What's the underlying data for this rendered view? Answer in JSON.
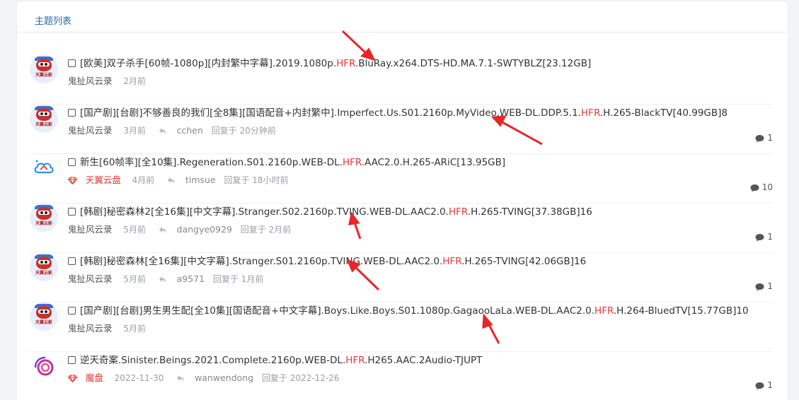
{
  "header": {
    "title": "主题列表"
  },
  "topics": [
    {
      "title_pre": "[欧美]双子杀手[60帧-1080p][内封繁中字幕].2019.1080p.",
      "hfr": "HFR",
      "title_post": ".BluRay.x264.DTS-HD.MA.7.1-SWTYBLZ[23.12GB]",
      "author": "鬼扯风云录",
      "time": "2月前",
      "replier": "",
      "reply_time": "",
      "count": ""
    },
    {
      "title_pre": "[国产剧][台剧]不够善良的我们[全8集][国语配音+内封繁中].Imperfect.Us.S01.2160p.MyVideo.WEB-DL.DDP.5.1.",
      "hfr": "HFR",
      "title_post": ".H.265-BlackTV[40.99GB]8",
      "author": "鬼扯风云录",
      "time": "3月前",
      "replier": "cchen",
      "reply_time": "回复于 20分钟前",
      "count": "1"
    },
    {
      "title_pre": "新生[60帧率][全10集].Regeneration.S01.2160p.WEB-DL.",
      "hfr": "HFR",
      "title_post": ".AAC2.0.H.265-ARiC[13.95GB]",
      "author": "天翼云盘",
      "time": "4月前",
      "replier": "timsue",
      "reply_time": "回复于 18小时前",
      "count": "10"
    },
    {
      "title_pre": "[韩剧]秘密森林2[全16集][中文字幕].Stranger.S02.2160p.TVING.WEB-DL.AAC2.0.",
      "hfr": "HFR",
      "title_post": ".H.265-TVING[37.38GB]16",
      "author": "鬼扯风云录",
      "time": "5月前",
      "replier": "dangye0929",
      "reply_time": "回复于 2月前",
      "count": "1"
    },
    {
      "title_pre": "[韩剧]秘密森林[全16集][中文字幕].Stranger.S01.2160p.TVING.WEB-DL.AAC2.0.",
      "hfr": "HFR",
      "title_post": ".H.265-TVING[42.06GB]16",
      "author": "鬼扯风云录",
      "time": "5月前",
      "replier": "a9571",
      "reply_time": "回复于 1月前",
      "count": "1"
    },
    {
      "title_pre": "[国产剧][台剧]男生男生配[全10集][国语配音+中文字幕].Boys.Like.Boys.S01.1080p.GagaooLaLa.WEB-DL.AAC2.0.",
      "hfr": "HFR",
      "title_post": ".H.264-BluedTV[15.77GB]10",
      "author": "鬼扯风云录",
      "time": "5月前",
      "replier": "",
      "reply_time": "",
      "count": ""
    },
    {
      "title_pre": "逆天奇案.Sinister.Beings.2021.Complete.2160p.WEB-DL.",
      "hfr": "HFR",
      "title_post": ".H265.AAC.2Audio-TJUPT",
      "author": "魔盘",
      "time": "2022-11-30",
      "replier": "wanwendong",
      "reply_time": "回复于 2022-12-26",
      "count": "1"
    }
  ],
  "avatar_brand": "天翼云影",
  "colors": {
    "accent": "#2c6aa8",
    "hfr": "#e53935",
    "annotation_arrow": "#e8262a"
  },
  "icons": {
    "reply": "reply-icon",
    "comment": "comment-icon",
    "gem": "gem-icon"
  }
}
